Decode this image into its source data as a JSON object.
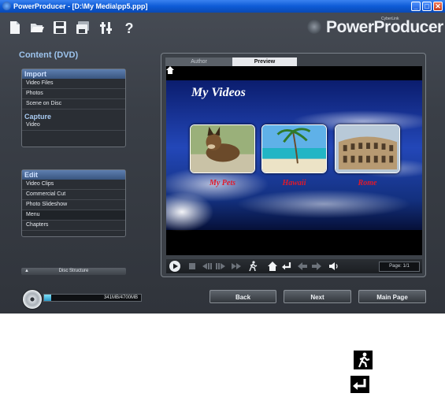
{
  "window": {
    "title": "PowerProducer - [D:\\My Media\\pp5.ppp]",
    "min": "_",
    "max": "□",
    "close": "✕"
  },
  "toolbar": {
    "icons": [
      "new-file-icon",
      "open-folder-icon",
      "save-icon",
      "save-as-icon",
      "settings-icon",
      "help-icon"
    ],
    "logo_small": "CyberLink",
    "logo": "PowerProducer"
  },
  "sidebar": {
    "title": "Content (DVD)",
    "import_header": "Import",
    "import_items": [
      "Video Files",
      "Photos",
      "Scene on Disc"
    ],
    "capture_header": "Capture",
    "capture_items": [
      "Video"
    ],
    "edit_header": "Edit",
    "edit_items": [
      "Video Clips",
      "Commercial Cut",
      "Photo Slideshow",
      "Menu",
      "Chapters"
    ],
    "disc_structure": "Disc Structure"
  },
  "preview": {
    "tabs": [
      "Author",
      "Preview"
    ],
    "active_tab": "Preview",
    "menu_title": "My Videos",
    "captions": [
      "My Pets",
      "Hawaii",
      "Rome"
    ],
    "page_label": "Page: 1/1"
  },
  "bottom": {
    "capacity_text": "341MB/4700MB",
    "capacity_fraction": 0.0726,
    "back": "Back",
    "next": "Next",
    "main_page": "Main Page"
  },
  "colors": {
    "accent": "#9dc4ee",
    "caption_red": "#e01a2a",
    "titlebar": "#0d5bd6"
  }
}
